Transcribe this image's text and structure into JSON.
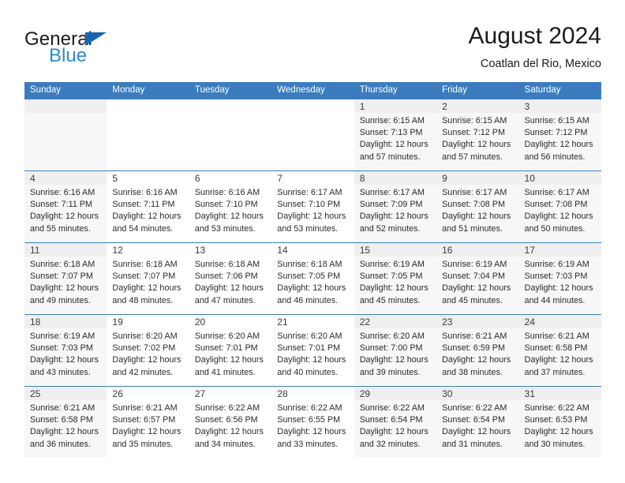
{
  "brand": {
    "name_part1": "General",
    "name_part2": "Blue",
    "triangle_color": "#1267b2",
    "blue_color": "#2a8ad4"
  },
  "header": {
    "title": "August 2024",
    "subtitle": "Coatlan del Rio, Mexico",
    "header_bg": "#3b7cbf"
  },
  "weekdays": [
    "Sunday",
    "Monday",
    "Tuesday",
    "Wednesday",
    "Thursday",
    "Friday",
    "Saturday"
  ],
  "weeks": [
    [
      {
        "day": "",
        "sunrise": "",
        "sunset": "",
        "daylight1": "",
        "daylight2": ""
      },
      {
        "day": "",
        "sunrise": "",
        "sunset": "",
        "daylight1": "",
        "daylight2": ""
      },
      {
        "day": "",
        "sunrise": "",
        "sunset": "",
        "daylight1": "",
        "daylight2": ""
      },
      {
        "day": "",
        "sunrise": "",
        "sunset": "",
        "daylight1": "",
        "daylight2": ""
      },
      {
        "day": "1",
        "sunrise": "Sunrise: 6:15 AM",
        "sunset": "Sunset: 7:13 PM",
        "daylight1": "Daylight: 12 hours",
        "daylight2": "and 57 minutes."
      },
      {
        "day": "2",
        "sunrise": "Sunrise: 6:15 AM",
        "sunset": "Sunset: 7:12 PM",
        "daylight1": "Daylight: 12 hours",
        "daylight2": "and 57 minutes."
      },
      {
        "day": "3",
        "sunrise": "Sunrise: 6:15 AM",
        "sunset": "Sunset: 7:12 PM",
        "daylight1": "Daylight: 12 hours",
        "daylight2": "and 56 minutes."
      }
    ],
    [
      {
        "day": "4",
        "sunrise": "Sunrise: 6:16 AM",
        "sunset": "Sunset: 7:11 PM",
        "daylight1": "Daylight: 12 hours",
        "daylight2": "and 55 minutes."
      },
      {
        "day": "5",
        "sunrise": "Sunrise: 6:16 AM",
        "sunset": "Sunset: 7:11 PM",
        "daylight1": "Daylight: 12 hours",
        "daylight2": "and 54 minutes."
      },
      {
        "day": "6",
        "sunrise": "Sunrise: 6:16 AM",
        "sunset": "Sunset: 7:10 PM",
        "daylight1": "Daylight: 12 hours",
        "daylight2": "and 53 minutes."
      },
      {
        "day": "7",
        "sunrise": "Sunrise: 6:17 AM",
        "sunset": "Sunset: 7:10 PM",
        "daylight1": "Daylight: 12 hours",
        "daylight2": "and 53 minutes."
      },
      {
        "day": "8",
        "sunrise": "Sunrise: 6:17 AM",
        "sunset": "Sunset: 7:09 PM",
        "daylight1": "Daylight: 12 hours",
        "daylight2": "and 52 minutes."
      },
      {
        "day": "9",
        "sunrise": "Sunrise: 6:17 AM",
        "sunset": "Sunset: 7:08 PM",
        "daylight1": "Daylight: 12 hours",
        "daylight2": "and 51 minutes."
      },
      {
        "day": "10",
        "sunrise": "Sunrise: 6:17 AM",
        "sunset": "Sunset: 7:08 PM",
        "daylight1": "Daylight: 12 hours",
        "daylight2": "and 50 minutes."
      }
    ],
    [
      {
        "day": "11",
        "sunrise": "Sunrise: 6:18 AM",
        "sunset": "Sunset: 7:07 PM",
        "daylight1": "Daylight: 12 hours",
        "daylight2": "and 49 minutes."
      },
      {
        "day": "12",
        "sunrise": "Sunrise: 6:18 AM",
        "sunset": "Sunset: 7:07 PM",
        "daylight1": "Daylight: 12 hours",
        "daylight2": "and 48 minutes."
      },
      {
        "day": "13",
        "sunrise": "Sunrise: 6:18 AM",
        "sunset": "Sunset: 7:06 PM",
        "daylight1": "Daylight: 12 hours",
        "daylight2": "and 47 minutes."
      },
      {
        "day": "14",
        "sunrise": "Sunrise: 6:18 AM",
        "sunset": "Sunset: 7:05 PM",
        "daylight1": "Daylight: 12 hours",
        "daylight2": "and 46 minutes."
      },
      {
        "day": "15",
        "sunrise": "Sunrise: 6:19 AM",
        "sunset": "Sunset: 7:05 PM",
        "daylight1": "Daylight: 12 hours",
        "daylight2": "and 45 minutes."
      },
      {
        "day": "16",
        "sunrise": "Sunrise: 6:19 AM",
        "sunset": "Sunset: 7:04 PM",
        "daylight1": "Daylight: 12 hours",
        "daylight2": "and 45 minutes."
      },
      {
        "day": "17",
        "sunrise": "Sunrise: 6:19 AM",
        "sunset": "Sunset: 7:03 PM",
        "daylight1": "Daylight: 12 hours",
        "daylight2": "and 44 minutes."
      }
    ],
    [
      {
        "day": "18",
        "sunrise": "Sunrise: 6:19 AM",
        "sunset": "Sunset: 7:03 PM",
        "daylight1": "Daylight: 12 hours",
        "daylight2": "and 43 minutes."
      },
      {
        "day": "19",
        "sunrise": "Sunrise: 6:20 AM",
        "sunset": "Sunset: 7:02 PM",
        "daylight1": "Daylight: 12 hours",
        "daylight2": "and 42 minutes."
      },
      {
        "day": "20",
        "sunrise": "Sunrise: 6:20 AM",
        "sunset": "Sunset: 7:01 PM",
        "daylight1": "Daylight: 12 hours",
        "daylight2": "and 41 minutes."
      },
      {
        "day": "21",
        "sunrise": "Sunrise: 6:20 AM",
        "sunset": "Sunset: 7:01 PM",
        "daylight1": "Daylight: 12 hours",
        "daylight2": "and 40 minutes."
      },
      {
        "day": "22",
        "sunrise": "Sunrise: 6:20 AM",
        "sunset": "Sunset: 7:00 PM",
        "daylight1": "Daylight: 12 hours",
        "daylight2": "and 39 minutes."
      },
      {
        "day": "23",
        "sunrise": "Sunrise: 6:21 AM",
        "sunset": "Sunset: 6:59 PM",
        "daylight1": "Daylight: 12 hours",
        "daylight2": "and 38 minutes."
      },
      {
        "day": "24",
        "sunrise": "Sunrise: 6:21 AM",
        "sunset": "Sunset: 6:58 PM",
        "daylight1": "Daylight: 12 hours",
        "daylight2": "and 37 minutes."
      }
    ],
    [
      {
        "day": "25",
        "sunrise": "Sunrise: 6:21 AM",
        "sunset": "Sunset: 6:58 PM",
        "daylight1": "Daylight: 12 hours",
        "daylight2": "and 36 minutes."
      },
      {
        "day": "26",
        "sunrise": "Sunrise: 6:21 AM",
        "sunset": "Sunset: 6:57 PM",
        "daylight1": "Daylight: 12 hours",
        "daylight2": "and 35 minutes."
      },
      {
        "day": "27",
        "sunrise": "Sunrise: 6:22 AM",
        "sunset": "Sunset: 6:56 PM",
        "daylight1": "Daylight: 12 hours",
        "daylight2": "and 34 minutes."
      },
      {
        "day": "28",
        "sunrise": "Sunrise: 6:22 AM",
        "sunset": "Sunset: 6:55 PM",
        "daylight1": "Daylight: 12 hours",
        "daylight2": "and 33 minutes."
      },
      {
        "day": "29",
        "sunrise": "Sunrise: 6:22 AM",
        "sunset": "Sunset: 6:54 PM",
        "daylight1": "Daylight: 12 hours",
        "daylight2": "and 32 minutes."
      },
      {
        "day": "30",
        "sunrise": "Sunrise: 6:22 AM",
        "sunset": "Sunset: 6:54 PM",
        "daylight1": "Daylight: 12 hours",
        "daylight2": "and 31 minutes."
      },
      {
        "day": "31",
        "sunrise": "Sunrise: 6:22 AM",
        "sunset": "Sunset: 6:53 PM",
        "daylight1": "Daylight: 12 hours",
        "daylight2": "and 30 minutes."
      }
    ]
  ]
}
